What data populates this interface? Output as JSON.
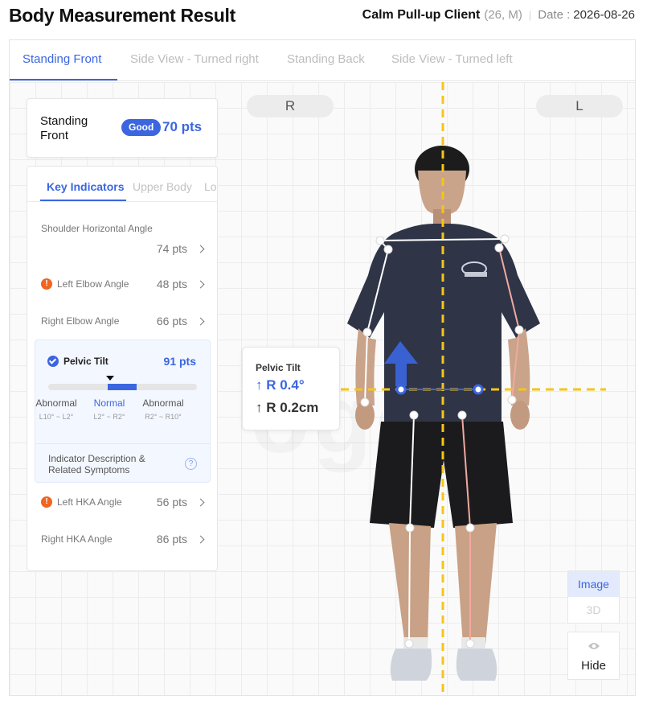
{
  "header": {
    "title": "Body Measurement Result",
    "client_name": "Calm Pull-up Client",
    "client_meta": "(26, M)",
    "date_label": "Date :",
    "date_value": "2026-08-26"
  },
  "view_tabs": [
    {
      "label": "Standing Front",
      "active": true
    },
    {
      "label": "Side View - Turned right",
      "active": false
    },
    {
      "label": "Standing Back",
      "active": false
    },
    {
      "label": "Side View - Turned left",
      "active": false
    }
  ],
  "viewer": {
    "right_side_label": "R",
    "left_side_label": "L"
  },
  "score_card": {
    "view_name": "Standing Front",
    "badge": "Good",
    "score": "70 pts"
  },
  "indicator_tabs": [
    {
      "label": "Key Indicators",
      "active": true
    },
    {
      "label": "Upper Body",
      "active": false
    },
    {
      "label": "Lo",
      "active": false
    }
  ],
  "indicators": [
    {
      "name": "Shoulder Horizontal Angle",
      "score": "74 pts",
      "warning": false
    },
    {
      "name": "Left Elbow Angle",
      "score": "48 pts",
      "warning": true
    },
    {
      "name": "Right Elbow Angle",
      "score": "66 pts",
      "warning": false
    },
    {
      "name": "Left HKA Angle",
      "score": "56 pts",
      "warning": true
    },
    {
      "name": "Right HKA Angle",
      "score": "86 pts",
      "warning": false
    }
  ],
  "expanded_indicator": {
    "name": "Pelvic Tilt",
    "score": "91 pts",
    "level": 0.55,
    "ranges": [
      {
        "label": "Abnormal",
        "range": "L10° ~ L2°"
      },
      {
        "label": "Normal",
        "range": "L2° ~ R2°"
      },
      {
        "label": "Abnormal",
        "range": "R2° ~ R10°"
      }
    ],
    "description": "Indicator Description & Related Symptoms",
    "help_icon": "question-circle-icon"
  },
  "callout": {
    "title": "Pelvic Tilt",
    "angle": "↑ R 0.4°",
    "distance": "↑ R 0.2cm"
  },
  "controls": {
    "image_label": "Image",
    "3d_label": "3D",
    "hide_label": "Hide",
    "hide_icon": "eye-icon"
  },
  "colors": {
    "accent": "#3b66e0",
    "warning": "#ef6522",
    "guide_line": "#f5c518",
    "left_skeleton": "#f0a9a0"
  }
}
